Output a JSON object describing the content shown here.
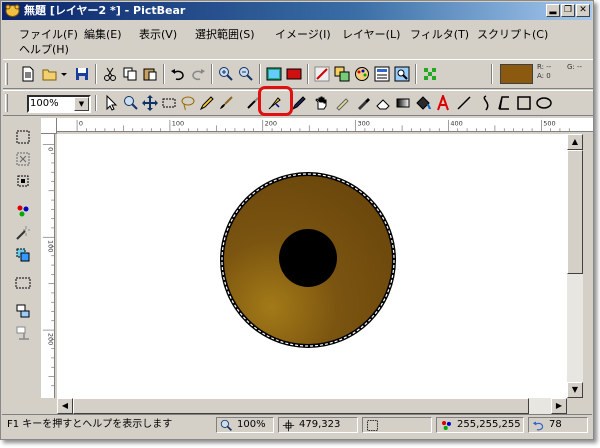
{
  "window": {
    "title": "無題 [レイヤー2 *] - PictBear",
    "minimize_label": "▂",
    "restore_label": "❐",
    "close_label": "✕"
  },
  "menu": {
    "items": [
      "ファイル(F)",
      "編集(E)",
      "表示(V)",
      "選択範囲(S)",
      "イメージ(I)",
      "レイヤー(L)",
      "フィルタ(T)",
      "スクリプト(C)",
      "ヘルプ(H)"
    ]
  },
  "toolbar1": {
    "icons": [
      "new-file-icon",
      "open-folder-icon",
      "save-icon",
      "cut-icon",
      "copy-icon",
      "paste-icon",
      "undo-icon",
      "redo-icon",
      "zoom-in-icon",
      "zoom-out-icon",
      "image-icon",
      "fill-rect-icon",
      "brush-settings-icon",
      "layers-icon",
      "palette-icon",
      "navigator-icon",
      "image-search-icon",
      "layer-tree-icon"
    ],
    "current_color": "#8b5a10",
    "color_readout": {
      "r": "R: --",
      "a": "A: 0",
      "g": "G: --"
    }
  },
  "toolbar2": {
    "zoom_value": "100%",
    "highlight_color": "#e01010",
    "tools": [
      "arrow-select-icon",
      "zoom-tool-icon",
      "move-tool-icon",
      "rect-select-icon",
      "lasso-icon",
      "pencil-icon",
      "brush-icon",
      "airbrush-icon",
      "smudge-icon",
      "hand-icon",
      "eraser-icon",
      "eyedropper-icon",
      "eraser2-icon",
      "gradient-icon",
      "fill-bucket-icon",
      "text-tool-icon",
      "line-tool-icon",
      "curve-tool-icon",
      "polyline-tool-icon",
      "rectangle-tool-icon",
      "ellipse-tool-icon"
    ]
  },
  "ruler": {
    "h_ticks": [
      "0",
      "100",
      "200",
      "300",
      "400",
      "500"
    ],
    "v_ticks": [
      "0",
      "100",
      "200"
    ]
  },
  "left_tools": [
    "select-all-icon",
    "deselect-icon",
    "crop-select-icon",
    "color-select-icon",
    "magic-wand-icon",
    "transform-icon",
    "marquee-icon",
    "merge-layer-icon",
    "anchor-icon"
  ],
  "canvas": {
    "outer_ring_color": "#000000",
    "iris_color": "#7a5410",
    "pupil_color": "#000000"
  },
  "status": {
    "help_text": "F1 キーを押すとヘルプを表示します",
    "zoom": "100%",
    "coords": "479,323",
    "color_value": "255,255,255",
    "history": "78"
  }
}
